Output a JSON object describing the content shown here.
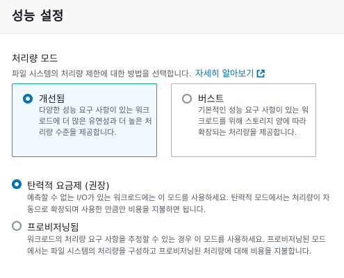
{
  "header": {
    "title": "성능 설정"
  },
  "throughput": {
    "title": "처리량 모드",
    "description": "파일 시스템의 처리량 제한에 대한 방법을 선택합니다.",
    "learn_more": "자세히 알아보기",
    "tiles": [
      {
        "label": "개선됨",
        "description": "다양한 성능 요구 사항이 있는 워크로드에 더 많은 유연성과 더 높은 처리량 수준을 제공합니다.",
        "selected": true
      },
      {
        "label": "버스트",
        "description": "기본적인 성능 요구 사항이 있는 워크로드를 위해 스토리지 양에 따라 확장되는 처리량을 제공합니다.",
        "selected": false
      }
    ],
    "options": [
      {
        "label": "탄력적 요금제 (권장)",
        "description": "예측할 수 없는 I/O가 있는 워크로드에는 이 모드를 사용하세요. 탄력적 모드에서는 처리량이 자동으로 확장되며 사용한 만큼만 비용을 지불하면 됩니다.",
        "selected": true
      },
      {
        "label": "프로비저닝됨",
        "description": "워크로드의 처리량 요구 사항을 추정할 수 있는 경우 이 모드를 사용하세요. 프로비저닝된 모드에서는 파일 시스템의 처리량을 구성하고 프로비저닝된 처리량에 대해 비용을 지불합니다.",
        "selected": false
      }
    ]
  },
  "colors": {
    "accent": "#0073bb",
    "tile_selected_border": "#00a1c9",
    "tile_selected_bg": "#f1faff",
    "text_secondary": "#545b64"
  },
  "icons": {
    "external_link": "external-link-icon"
  }
}
